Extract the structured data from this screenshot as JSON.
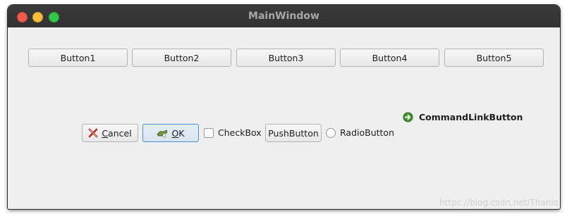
{
  "window": {
    "title": "MainWindow"
  },
  "buttons_row": [
    {
      "label": "Button1"
    },
    {
      "label": "Button2"
    },
    {
      "label": "Button3"
    },
    {
      "label": "Button4"
    },
    {
      "label": "Button5"
    }
  ],
  "controls": {
    "cancel_accel": "C",
    "cancel_rest": "ancel",
    "ok_accel": "O",
    "ok_rest": "K",
    "checkbox_label": "CheckBox",
    "checkbox_checked": false,
    "pushbutton_label": "PushButton",
    "radiobutton_label": "RadioButton",
    "radiobutton_selected": false
  },
  "command_link": {
    "label": "CommandLinkButton",
    "icon": "arrow-right-circle-icon"
  },
  "watermark": "https://blog.csdn.net/Thanlo",
  "colors": {
    "titlebar": "#353535",
    "window_bg": "#efefef",
    "focus_border": "#4a8fcd",
    "close": "#ef5b4f",
    "minimize": "#f4bd3d",
    "maximize": "#32c748"
  }
}
